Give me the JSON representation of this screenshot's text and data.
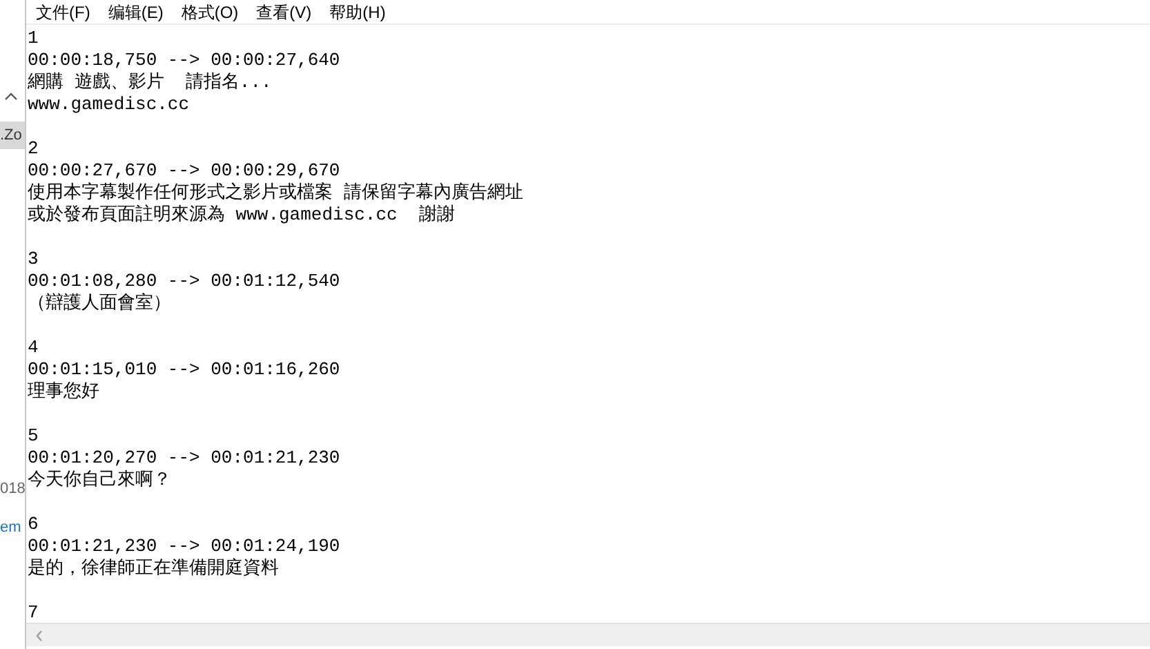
{
  "background_window": {
    "fragments": [
      ".Zo",
      "018",
      "em"
    ]
  },
  "menu": [
    "文件(F)",
    "编辑(E)",
    "格式(O)",
    "查看(V)",
    "帮助(H)"
  ],
  "subtitles": [
    {
      "index": "1",
      "time": "00:00:18,750 --> 00:00:27,640",
      "lines": [
        "網購 遊戲、影片  請指名...",
        "www.gamedisc.cc"
      ]
    },
    {
      "index": "2",
      "time": "00:00:27,670 --> 00:00:29,670",
      "lines": [
        "使用本字幕製作任何形式之影片或檔案 請保留字幕內廣告網址",
        "或於發布頁面註明來源為 www.gamedisc.cc  謝謝"
      ]
    },
    {
      "index": "3",
      "time": "00:01:08,280 --> 00:01:12,540",
      "lines": [
        "（辯護人面會室）"
      ]
    },
    {
      "index": "4",
      "time": "00:01:15,010 --> 00:01:16,260",
      "lines": [
        "理事您好"
      ]
    },
    {
      "index": "5",
      "time": "00:01:20,270 --> 00:01:21,230",
      "lines": [
        "今天你自己來啊？"
      ]
    },
    {
      "index": "6",
      "time": "00:01:21,230 --> 00:01:24,190",
      "lines": [
        "是的，徐律師正在準備開庭資料"
      ]
    },
    {
      "index": "7"
    }
  ]
}
